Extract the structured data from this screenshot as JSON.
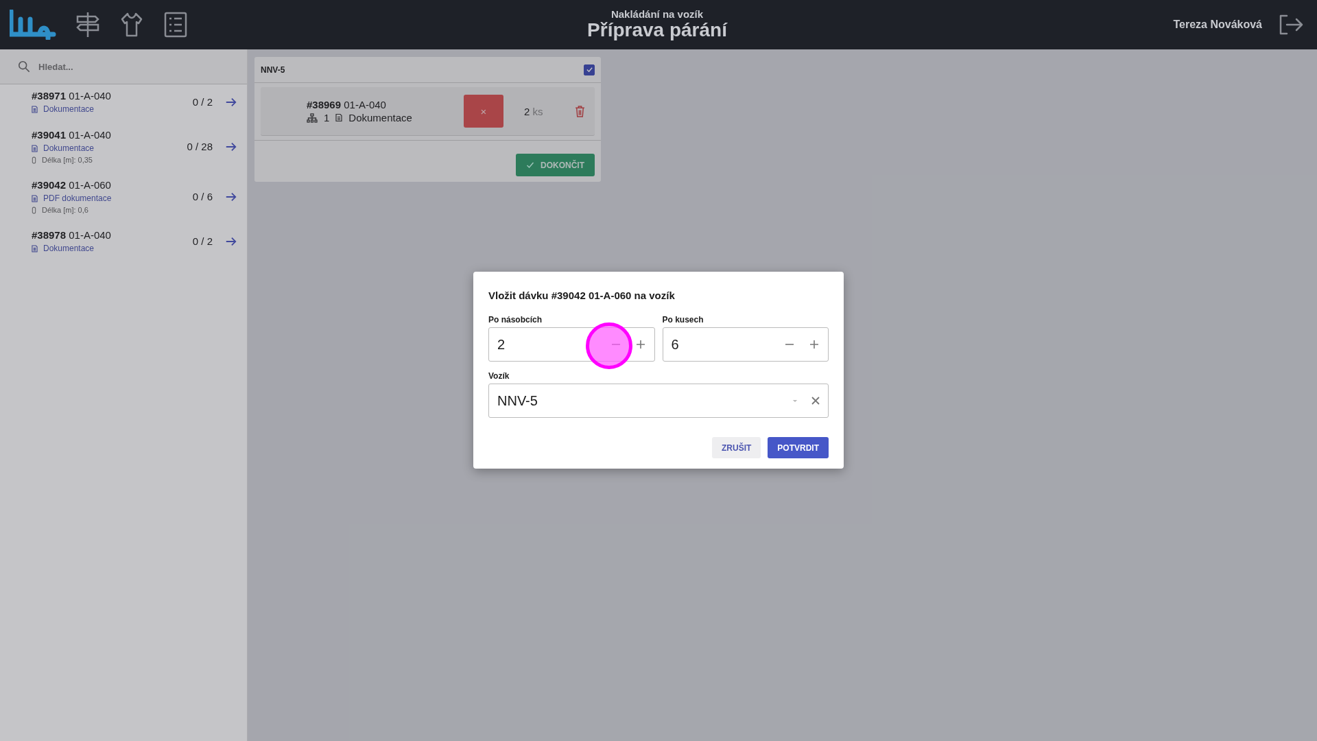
{
  "header": {
    "subtitle": "Nakládání na vozík",
    "title": "Příprava párání",
    "user": "Tereza Nováková"
  },
  "search": {
    "placeholder": "Hledat..."
  },
  "orders": [
    {
      "number": "#38971",
      "location": "01-A-040",
      "doc": "Dokumentace",
      "count": "0 / 2"
    },
    {
      "number": "#39041",
      "location": "01-A-040",
      "doc": "Dokumentace",
      "length": "Délka [m]: 0,35",
      "count": "0 / 28"
    },
    {
      "number": "#39042",
      "location": "01-A-060",
      "doc": "PDF dokumentace",
      "length": "Délka [m]: 0,6",
      "count": "0 / 6"
    },
    {
      "number": "#38978",
      "location": "01-A-040",
      "doc": "Dokumentace",
      "count": "0 / 2"
    }
  ],
  "cart": {
    "name": "NNV-5",
    "checked": true,
    "items": [
      {
        "number": "#38969",
        "location": "01-A-040",
        "tree_count": "1",
        "doc": "Dokumentace",
        "remove": "×",
        "quantity": "2",
        "unit": "ks"
      }
    ],
    "finish_button": "DOKONČIT"
  },
  "dialog": {
    "title": "Vložit dávku #39042 01-A-060 na vozík",
    "steppers": [
      {
        "label": "Po násobcích",
        "value": "2"
      },
      {
        "label": "Po kusech",
        "value": "6"
      }
    ],
    "cart_select": {
      "label": "Vozík",
      "value": "NNV-5"
    },
    "buttons": [
      {
        "kind": "cancel",
        "label": "ZRUŠIT"
      },
      {
        "kind": "confirm",
        "label": "POTVRDIT"
      }
    ]
  }
}
